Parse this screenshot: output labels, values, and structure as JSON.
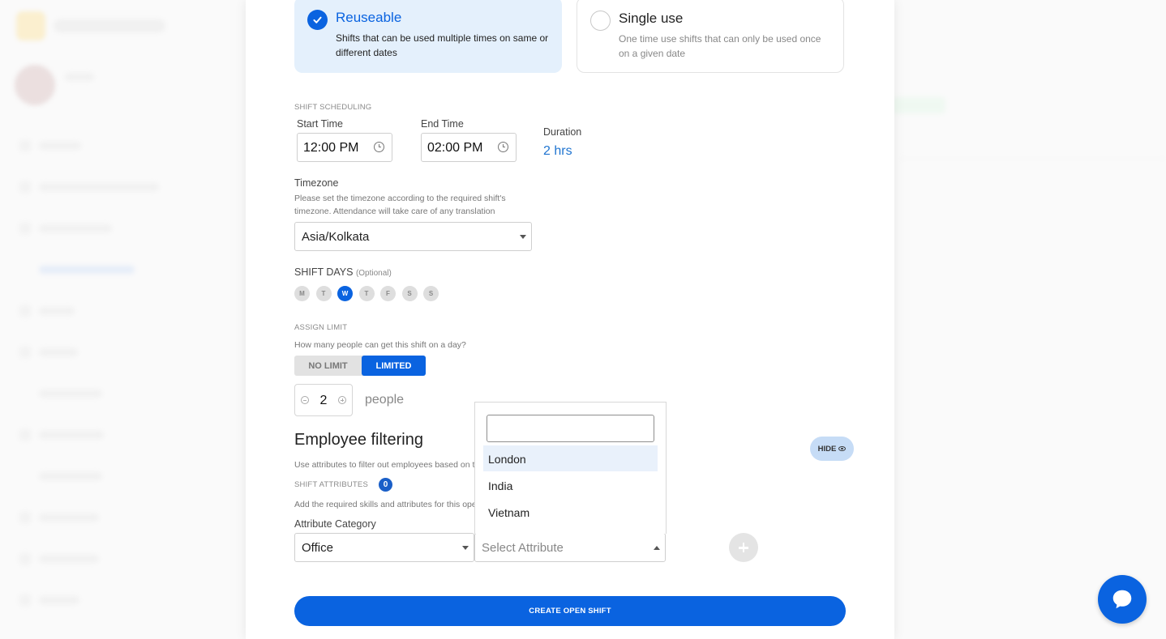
{
  "shift_type": {
    "reuseable": {
      "title": "Reuseable",
      "description": "Shifts that can be used multiple times on same or different dates",
      "selected": true
    },
    "single_use": {
      "title": "Single use",
      "description": "One time use shifts that can only be used once on a given date",
      "selected": false
    }
  },
  "scheduling": {
    "section_label": "SHIFT SCHEDULING",
    "start_time_label": "Start Time",
    "start_time_value": "12:00 PM",
    "end_time_label": "End Time",
    "end_time_value": "02:00 PM",
    "duration_label": "Duration",
    "duration_value": "2 hrs"
  },
  "timezone": {
    "label": "Timezone",
    "hint": "Please set the timezone according to the required shift's timezone. Attendance will take care of any translation",
    "value": "Asia/Kolkata"
  },
  "shift_days": {
    "label": "SHIFT DAYS",
    "optional": "(Optional)",
    "days": [
      {
        "letter": "M",
        "active": false
      },
      {
        "letter": "T",
        "active": false
      },
      {
        "letter": "W",
        "active": true
      },
      {
        "letter": "T",
        "active": false
      },
      {
        "letter": "F",
        "active": false
      },
      {
        "letter": "S",
        "active": false
      },
      {
        "letter": "S",
        "active": false
      }
    ]
  },
  "assign_limit": {
    "label": "ASSIGN LIMIT",
    "hint": "How many people can get this shift on a day?",
    "no_limit": "NO LIMIT",
    "limited": "LIMITED",
    "selected": "LIMITED",
    "count": "2",
    "unit": "people"
  },
  "employee_filtering": {
    "title": "Employee filtering",
    "hint": "Use attributes to filter out employees based on th",
    "hide_label": "HIDE",
    "attributes_label": "SHIFT ATTRIBUTES",
    "attributes_count": "0",
    "attributes_hint": "Add the required skills and attributes for this ope",
    "category_label": "Attribute Category",
    "category_value": "Office",
    "attribute_placeholder": "Select Attribute",
    "dropdown_options": [
      "London",
      "India",
      "Vietnam"
    ],
    "highlighted_option": "London"
  },
  "actions": {
    "create_label": "CREATE OPEN SHIFT"
  },
  "colors": {
    "primary": "#0a63e0",
    "selected_card_bg": "#e4f0fc",
    "duration_text": "#1f74d0"
  },
  "icons": [
    "check-icon",
    "clock-icon",
    "chevron-down-icon",
    "chevron-up-icon",
    "minus-icon",
    "plus-icon",
    "eye-icon",
    "chat-icon"
  ]
}
